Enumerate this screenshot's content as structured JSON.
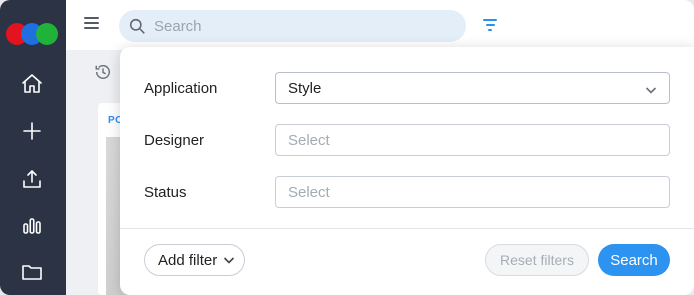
{
  "rail": {
    "icons": [
      "home-icon",
      "plus-icon",
      "upload-icon",
      "bar-chart-icon",
      "folder-icon"
    ]
  },
  "topbar": {
    "search_placeholder": "Search",
    "filter_icon_color": "#2a8ff0"
  },
  "background": {
    "card_label": "PO"
  },
  "filter_panel": {
    "rows": [
      {
        "label": "Application",
        "value": "Style",
        "placeholder": ""
      },
      {
        "label": "Designer",
        "value": "",
        "placeholder": "Select"
      },
      {
        "label": "Status",
        "value": "",
        "placeholder": "Select"
      }
    ],
    "add_filter_label": "Add filter",
    "reset_label": "Reset filters",
    "search_label": "Search"
  },
  "colors": {
    "rail_bg": "#2b3345",
    "accent": "#2d93f0",
    "logo": [
      "#e3131f",
      "#1f6fe0",
      "#1fb33a"
    ]
  }
}
